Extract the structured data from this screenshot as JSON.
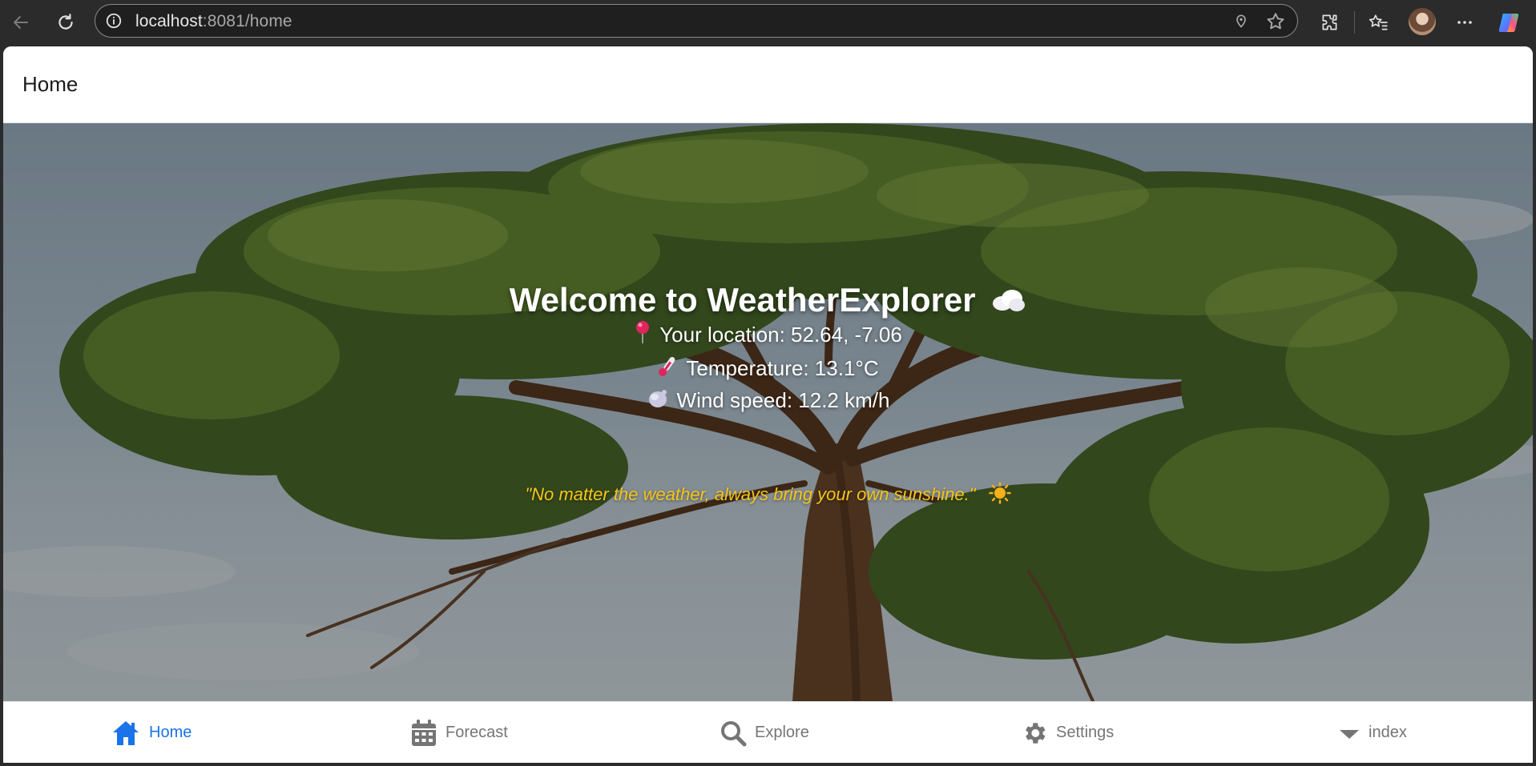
{
  "browser": {
    "url_host": "localhost",
    "url_rest": ":8081/home"
  },
  "app": {
    "page_title": "Home"
  },
  "hero": {
    "welcome": "Welcome to WeatherExplorer",
    "location_label": "Your location: 52.64, -7.06",
    "temperature_label": "Temperature: 13.1°C",
    "wind_label": "Wind speed: 12.2 km/h",
    "quote": "\"No matter the weather, always bring your own sunshine.\"",
    "quote_color": "#f5c518"
  },
  "bottom_nav": {
    "active_color": "#1a73e8",
    "inactive_color": "#757575",
    "items": [
      {
        "label": "Home",
        "icon": "home-icon",
        "active": true
      },
      {
        "label": "Forecast",
        "icon": "calendar-icon",
        "active": false
      },
      {
        "label": "Explore",
        "icon": "search-icon",
        "active": false
      },
      {
        "label": "Settings",
        "icon": "gear-icon",
        "active": false
      },
      {
        "label": "index",
        "icon": "caret-down-icon",
        "active": false
      }
    ]
  }
}
